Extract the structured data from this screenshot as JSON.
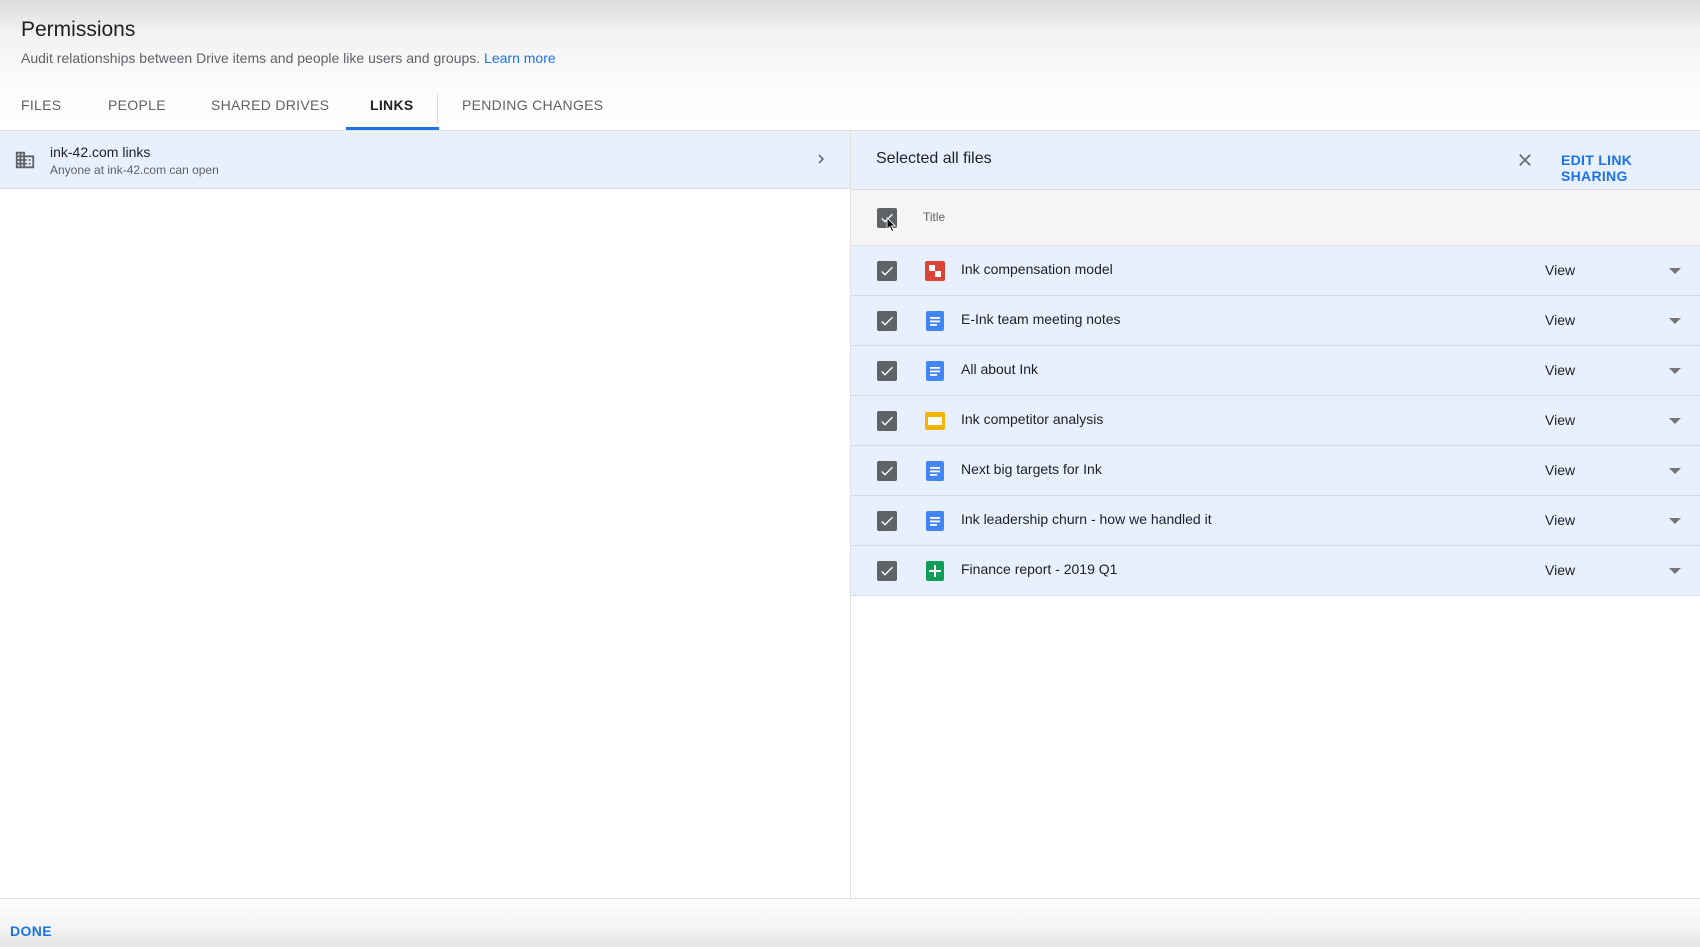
{
  "header": {
    "title": "Permissions",
    "subtitle": "Audit relationships between Drive items and people like users and groups.",
    "learn_more": "Learn more"
  },
  "tabs": [
    {
      "label": "FILES",
      "active": false
    },
    {
      "label": "PEOPLE",
      "active": false
    },
    {
      "label": "SHARED DRIVES",
      "active": false
    },
    {
      "label": "LINKS",
      "active": true
    },
    {
      "label": "PENDING CHANGES",
      "active": false
    }
  ],
  "left_panel": {
    "link_group": {
      "title": "ink-42.com links",
      "subtitle": "Anyone at ink-42.com can open",
      "icon": "building-icon"
    }
  },
  "right_panel": {
    "selection_title": "Selected all files",
    "edit_link_sharing": "EDIT LINK SHARING",
    "column_title": "Title",
    "files": [
      {
        "name": "Ink compensation model",
        "type": "pdf",
        "icon_color": "#db4437",
        "permission": "View",
        "checked": true
      },
      {
        "name": "E-Ink team meeting notes",
        "type": "doc",
        "icon_color": "#4285f4",
        "permission": "View",
        "checked": true
      },
      {
        "name": "All about Ink",
        "type": "doc",
        "icon_color": "#4285f4",
        "permission": "View",
        "checked": true
      },
      {
        "name": "Ink competitor analysis",
        "type": "slides",
        "icon_color": "#f4b400",
        "permission": "View",
        "checked": true
      },
      {
        "name": "Next big targets for Ink",
        "type": "doc",
        "icon_color": "#4285f4",
        "permission": "View",
        "checked": true
      },
      {
        "name": "Ink leadership churn - how we handled it",
        "type": "doc",
        "icon_color": "#4285f4",
        "permission": "View",
        "checked": true
      },
      {
        "name": "Finance report - 2019 Q1",
        "type": "sheet",
        "icon_color": "#0f9d58",
        "permission": "View",
        "checked": true
      }
    ]
  },
  "footer": {
    "done": "DONE"
  },
  "colors": {
    "accent": "#1a73e8",
    "selected_row": "#e8f0fe",
    "checkbox": "#5f6368"
  }
}
